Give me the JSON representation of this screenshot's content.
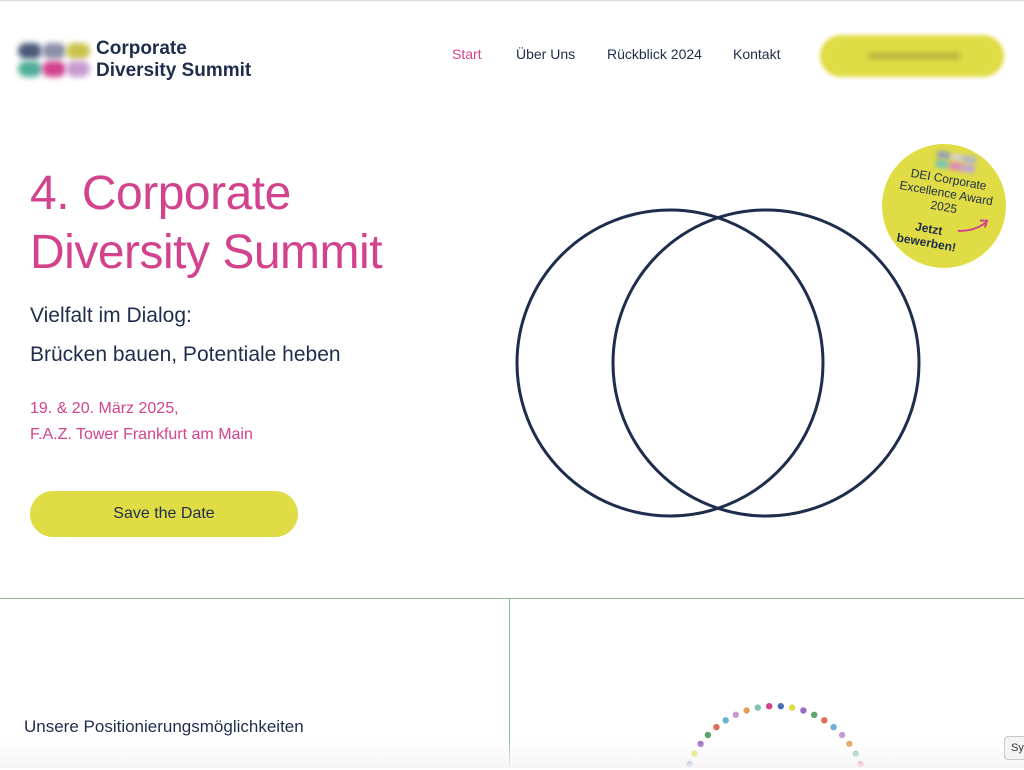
{
  "colors": {
    "accent": "#d2428d",
    "yellow": "#e0dc45",
    "navy": "#1f2d4d",
    "divider": "#8fb79a"
  },
  "brand": {
    "name_line1": "Corporate",
    "name_line2": "Diversity Summit"
  },
  "nav": {
    "items": [
      {
        "label": "Start",
        "active": true
      },
      {
        "label": "Über Uns",
        "active": false
      },
      {
        "label": "Rückblick 2024",
        "active": false
      },
      {
        "label": "Kontakt",
        "active": false
      }
    ]
  },
  "hero": {
    "title_line1": "4. Corporate",
    "title_line2": "Diversity Summit",
    "subtitle_line1": "Vielfalt im Dialog:",
    "subtitle_line2": "Brücken bauen, Potentiale heben",
    "date_line1": "19. & 20. März 2025,",
    "date_line2": "F.A.Z. Tower Frankfurt am Main",
    "cta_label": "Save the Date"
  },
  "award_badge": {
    "title_line1": "DEI Corporate",
    "title_line2": "Excellence Award",
    "title_line3": "2025",
    "cta_line1": "Jetzt",
    "cta_line2": "bewerben!"
  },
  "section": {
    "label": "Unsere Positionierungsmöglichkeiten"
  },
  "widget": {
    "label": "Sy"
  }
}
